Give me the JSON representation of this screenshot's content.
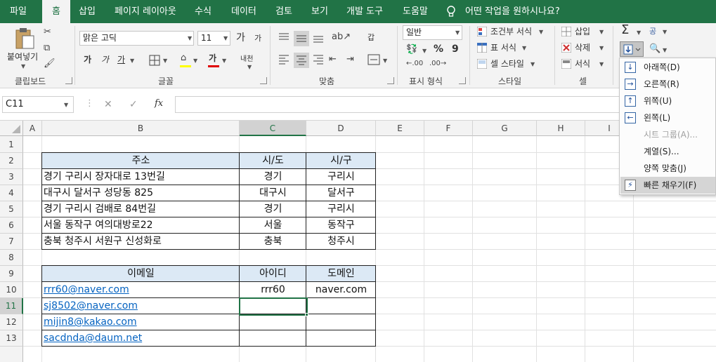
{
  "tabs": [
    "파일",
    "홈",
    "삽입",
    "페이지 레이아웃",
    "수식",
    "데이터",
    "검토",
    "보기",
    "개발 도구",
    "도움말"
  ],
  "tell_me": "어떤 작업을 원하시나요?",
  "ribbon": {
    "paste_label": "붙여넣기",
    "font_name": "맑은 고딕",
    "font_size": "11",
    "grow_font": "가",
    "shrink_font": "가",
    "bold": "가",
    "italic": "가",
    "underline": "가",
    "font_color_glyph": "가",
    "phonetic_glyph": "내천",
    "wrap_text_glyph": "갑",
    "number_format": "일반",
    "percent": "%",
    "comma": "9",
    "conditional_format": "조건부 서식",
    "format_as_table": "표 서식",
    "cell_styles": "셀 스타일",
    "insert": "삽입",
    "delete": "삭제",
    "format": "서식",
    "sort_glyph": "공",
    "autosum_glyph": "Σ",
    "groups": {
      "clipboard": "클립보드",
      "font": "글꼴",
      "alignment": "맞춤",
      "number": "표시 형식",
      "styles": "스타일",
      "cells": "셀"
    }
  },
  "formula_bar": {
    "name_box": "C11",
    "fx": "fx",
    "cancel": "✕",
    "enter": "✓",
    "value": ""
  },
  "columns": [
    "A",
    "B",
    "C",
    "D",
    "E",
    "F",
    "G",
    "H",
    "I"
  ],
  "rows": [
    "1",
    "2",
    "3",
    "4",
    "5",
    "6",
    "7",
    "8",
    "9",
    "10",
    "11",
    "12",
    "13"
  ],
  "table1": {
    "headers": [
      "주소",
      "시/도",
      "시/구"
    ],
    "rows": [
      [
        "경기 구리시 장자대로 13번길",
        "경기",
        "구리시"
      ],
      [
        "대구시 달서구 성당동 825",
        "대구시",
        "달서구"
      ],
      [
        "경기 구리시 검배로 84번길",
        "경기",
        "구리시"
      ],
      [
        "서울 동작구 여의대방로22",
        "서울",
        "동작구"
      ],
      [
        "충북 청주시 서원구 신성화로",
        "충북",
        "청주시"
      ]
    ]
  },
  "table2": {
    "headers": [
      "이메일",
      "아이디",
      "도메인"
    ],
    "rows": [
      [
        "rrr60@naver.com",
        "rrr60",
        "naver.com"
      ],
      [
        "sj8502@naver.com",
        "",
        ""
      ],
      [
        "mijin8@kakao.com",
        "",
        ""
      ],
      [
        "sacdnda@daum.net",
        "",
        ""
      ]
    ]
  },
  "fill_menu": {
    "items": [
      {
        "label": "아래쪽(D)",
        "icon": "arrow-down-icon",
        "disabled": false
      },
      {
        "label": "오른쪽(R)",
        "icon": "arrow-right-icon",
        "disabled": false
      },
      {
        "label": "위쪽(U)",
        "icon": "arrow-up-icon",
        "disabled": false
      },
      {
        "label": "왼쪽(L)",
        "icon": "arrow-left-icon",
        "disabled": false
      },
      {
        "label": "시트 그룹(A)...",
        "icon": "",
        "disabled": true
      },
      {
        "label": "계열(S)...",
        "icon": "",
        "disabled": false
      },
      {
        "label": "양쪽 맞춤(J)",
        "icon": "",
        "disabled": false
      },
      {
        "label": "빠른 채우기(F)",
        "icon": "flash-fill-icon",
        "disabled": false
      }
    ]
  },
  "colors": {
    "brand": "#217346",
    "link": "#0563c1",
    "header_fill": "#dce9f5"
  }
}
